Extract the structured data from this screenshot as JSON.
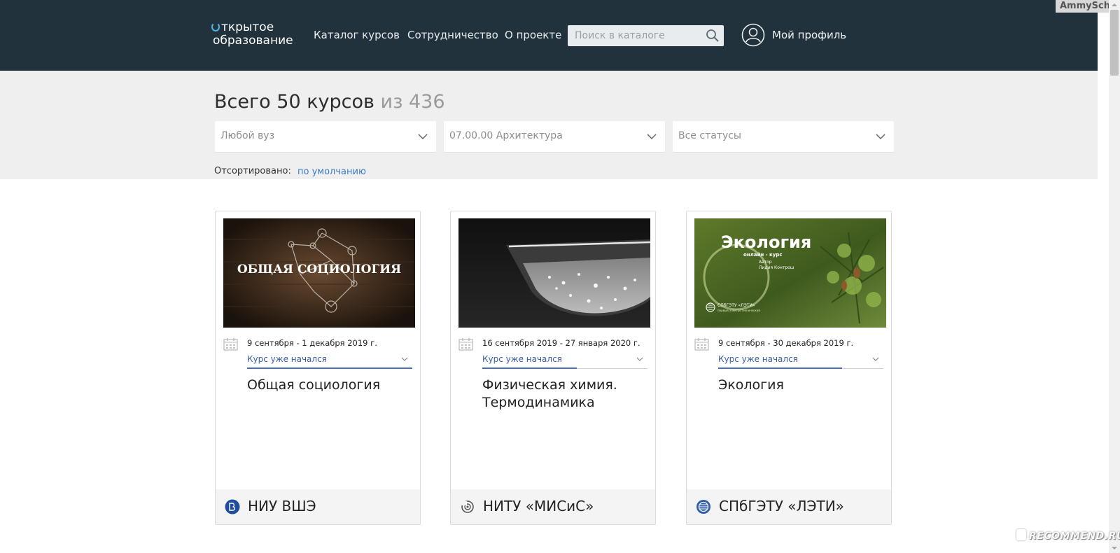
{
  "header": {
    "logo_line1": "ткрытое",
    "logo_line2": "образование",
    "nav": [
      {
        "label": "Каталог курсов"
      },
      {
        "label": "Сотрудничество"
      },
      {
        "label": "О проекте"
      }
    ],
    "search_placeholder": "Поиск в каталоге",
    "profile_label": "Мой профиль"
  },
  "watermark_top": "AmmySchtoz",
  "catalog": {
    "total_main": "Всего 50 курсов",
    "total_of": "из 436",
    "filters": [
      {
        "value": "Любой вуз"
      },
      {
        "value": "07.00.00 Архитектура"
      },
      {
        "value": "Все статусы"
      }
    ],
    "sort_label": "Отсортировано:",
    "sort_value": "по умолчанию"
  },
  "cards": [
    {
      "image_text": "ОБЩАЯ СОЦИОЛОГИЯ",
      "dates": "9 сентября - 1 декабря 2019 г.",
      "status": "Курс уже начался",
      "progress": 1.0,
      "title": "Общая социология",
      "university": "НИУ ВШЭ"
    },
    {
      "image_text": "",
      "dates": "16 сентября 2019 - 27 января 2020 г.",
      "status": "Курс уже начался",
      "progress": 0.57,
      "title": "Физическая химия. Термодинамика",
      "university": "НИТУ «МИСиС»"
    },
    {
      "image_text": "Экология",
      "image_sub": "онлайн - курс",
      "image_author": "Автор",
      "image_author_name": "Лидия Контрош",
      "image_org": "СПбГЭТУ «ЛЭТИ»",
      "image_org_sub": "первый электротехнический",
      "dates": "9 сентября - 30 декабря 2019 г.",
      "status": "Курс уже начался",
      "progress": 0.75,
      "title": "Экология",
      "university": "СПбГЭТУ «ЛЭТИ»"
    }
  ],
  "watermark_bottom": "RECOMMEND.RU"
}
